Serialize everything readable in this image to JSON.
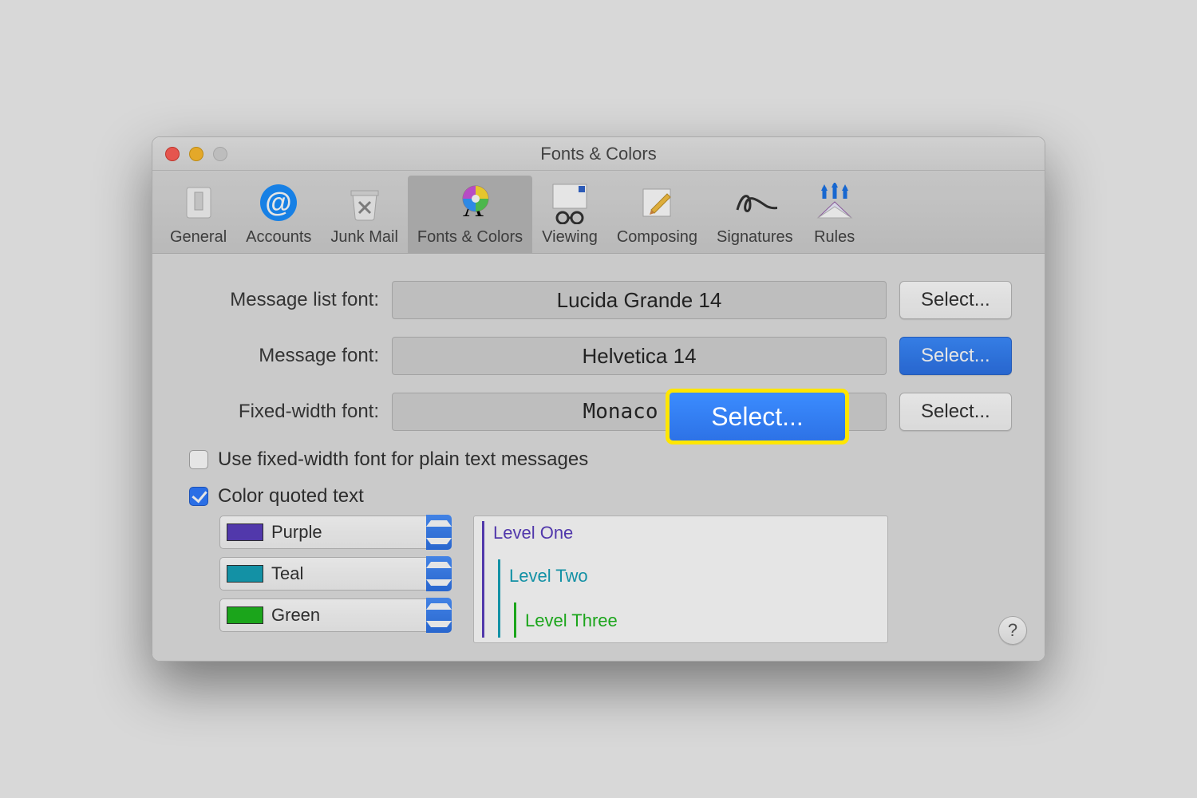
{
  "window_title": "Fonts & Colors",
  "toolbar": {
    "items": [
      {
        "id": "general",
        "label": "General"
      },
      {
        "id": "accounts",
        "label": "Accounts"
      },
      {
        "id": "junk-mail",
        "label": "Junk Mail"
      },
      {
        "id": "fonts-colors",
        "label": "Fonts & Colors"
      },
      {
        "id": "viewing",
        "label": "Viewing"
      },
      {
        "id": "composing",
        "label": "Composing"
      },
      {
        "id": "signatures",
        "label": "Signatures"
      },
      {
        "id": "rules",
        "label": "Rules"
      }
    ],
    "selected": "fonts-colors"
  },
  "fonts": {
    "message_list": {
      "label": "Message list font:",
      "value": "Lucida Grande 14",
      "button": "Select..."
    },
    "message": {
      "label": "Message font:",
      "value": "Helvetica 14",
      "button": "Select..."
    },
    "fixed_width": {
      "label": "Fixed-width font:",
      "value": "Monaco 10",
      "button": "Select..."
    }
  },
  "select_button_label": "Select...",
  "checkboxes": {
    "use_fixed_width": {
      "label": "Use fixed-width font for plain text messages",
      "checked": false
    },
    "color_quoted": {
      "label": "Color quoted text",
      "checked": true
    }
  },
  "color_levels": {
    "swatches": [
      {
        "name": "Purple",
        "color": "#5b3fbf"
      },
      {
        "name": "Teal",
        "color": "#16a2b8"
      },
      {
        "name": "Green",
        "color": "#1fb81f"
      }
    ],
    "preview": [
      {
        "label": "Level One",
        "color": "#5b3fbf"
      },
      {
        "label": "Level Two",
        "color": "#16a2b8"
      },
      {
        "label": "Level Three",
        "color": "#1fb81f"
      }
    ]
  },
  "help_label": "?",
  "callout_label": "Select..."
}
